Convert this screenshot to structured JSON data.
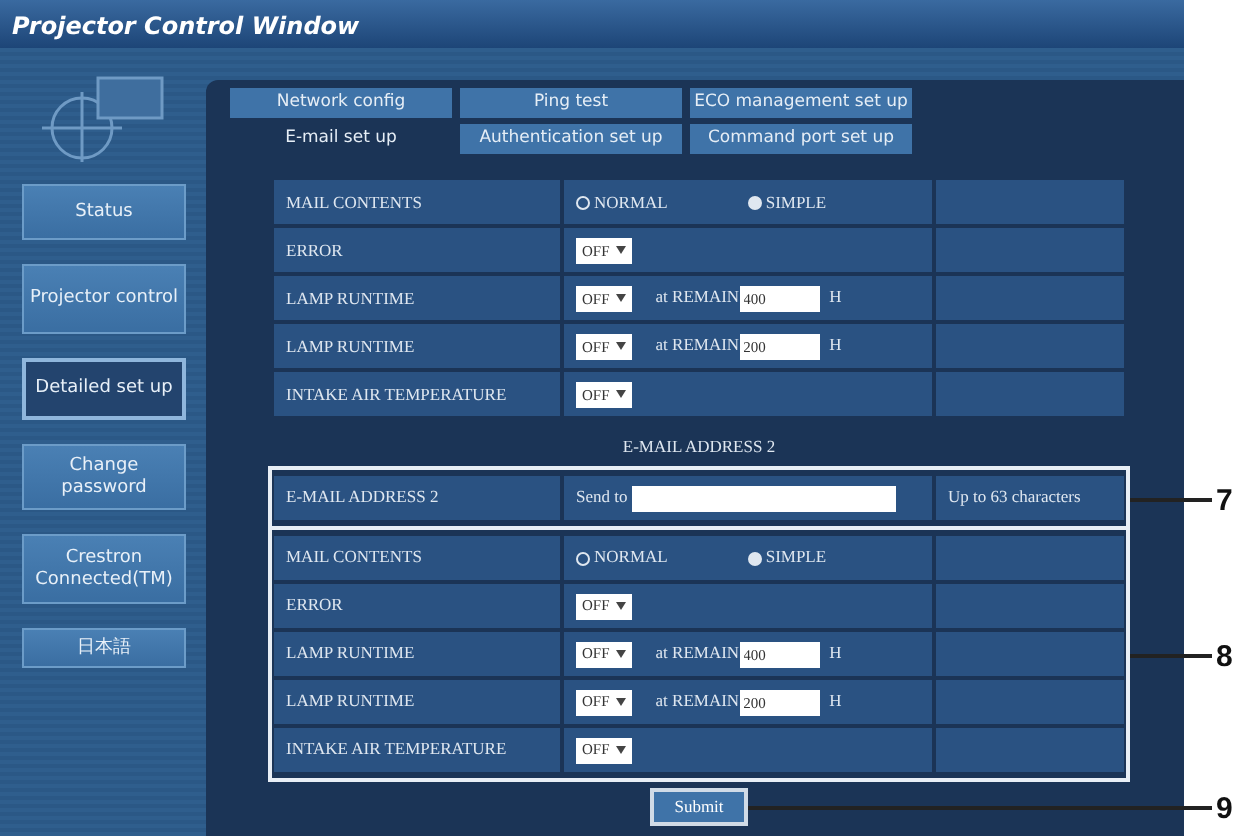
{
  "window": {
    "title": "Projector Control Window"
  },
  "sidebar": {
    "items": [
      {
        "label": "Status",
        "selected": false
      },
      {
        "label": "Projector control",
        "selected": false
      },
      {
        "label": "Detailed set up",
        "selected": true
      },
      {
        "label": "Change password",
        "selected": false
      },
      {
        "label": "Crestron Connected(TM)",
        "selected": false
      },
      {
        "label": "日本語",
        "selected": false
      }
    ]
  },
  "tab_rows": [
    {
      "tabs": [
        {
          "label": "Network config",
          "selected": false
        },
        {
          "label": "Ping test",
          "selected": false
        },
        {
          "label": "ECO management set up",
          "selected": false
        }
      ]
    },
    {
      "tabs": [
        {
          "label": "E-mail set up",
          "selected": true
        },
        {
          "label": "Authentication set up",
          "selected": false
        },
        {
          "label": "Command port set up",
          "selected": false
        }
      ]
    }
  ],
  "settings_top": {
    "rows": [
      {
        "kind": "radio",
        "label": "MAIL CONTENTS",
        "options": [
          {
            "label": "NORMAL",
            "selected": false
          },
          {
            "label": "SIMPLE",
            "selected": true
          }
        ]
      },
      {
        "kind": "select",
        "label": "ERROR",
        "value": "OFF"
      },
      {
        "kind": "select_remain",
        "label": "LAMP RUNTIME",
        "value": "OFF",
        "remain_label": "at REMAIN",
        "remain_value": "400",
        "unit": "H"
      },
      {
        "kind": "select_remain",
        "label": "LAMP RUNTIME",
        "value": "OFF",
        "remain_label": "at REMAIN",
        "remain_value": "200",
        "unit": "H"
      },
      {
        "kind": "select",
        "label": "INTAKE AIR TEMPERATURE",
        "value": "OFF"
      }
    ]
  },
  "address_heading": "E-MAIL ADDRESS 2",
  "address_row": {
    "label": "E-MAIL ADDRESS 2",
    "prefix": "Send to",
    "note": "Up to 63 characters"
  },
  "settings_bottom": {
    "rows": [
      {
        "kind": "radio",
        "label": "MAIL CONTENTS",
        "options": [
          {
            "label": "NORMAL",
            "selected": false
          },
          {
            "label": "SIMPLE",
            "selected": true
          }
        ]
      },
      {
        "kind": "select",
        "label": "ERROR",
        "value": "OFF"
      },
      {
        "kind": "select_remain",
        "label": "LAMP RUNTIME",
        "value": "OFF",
        "remain_label": "at REMAIN",
        "remain_value": "400",
        "unit": "H"
      },
      {
        "kind": "select_remain",
        "label": "LAMP RUNTIME",
        "value": "OFF",
        "remain_label": "at REMAIN",
        "remain_value": "200",
        "unit": "H"
      },
      {
        "kind": "select",
        "label": "INTAKE AIR TEMPERATURE",
        "value": "OFF"
      }
    ]
  },
  "submit": "Submit",
  "callouts": [
    "7",
    "8",
    "9"
  ]
}
